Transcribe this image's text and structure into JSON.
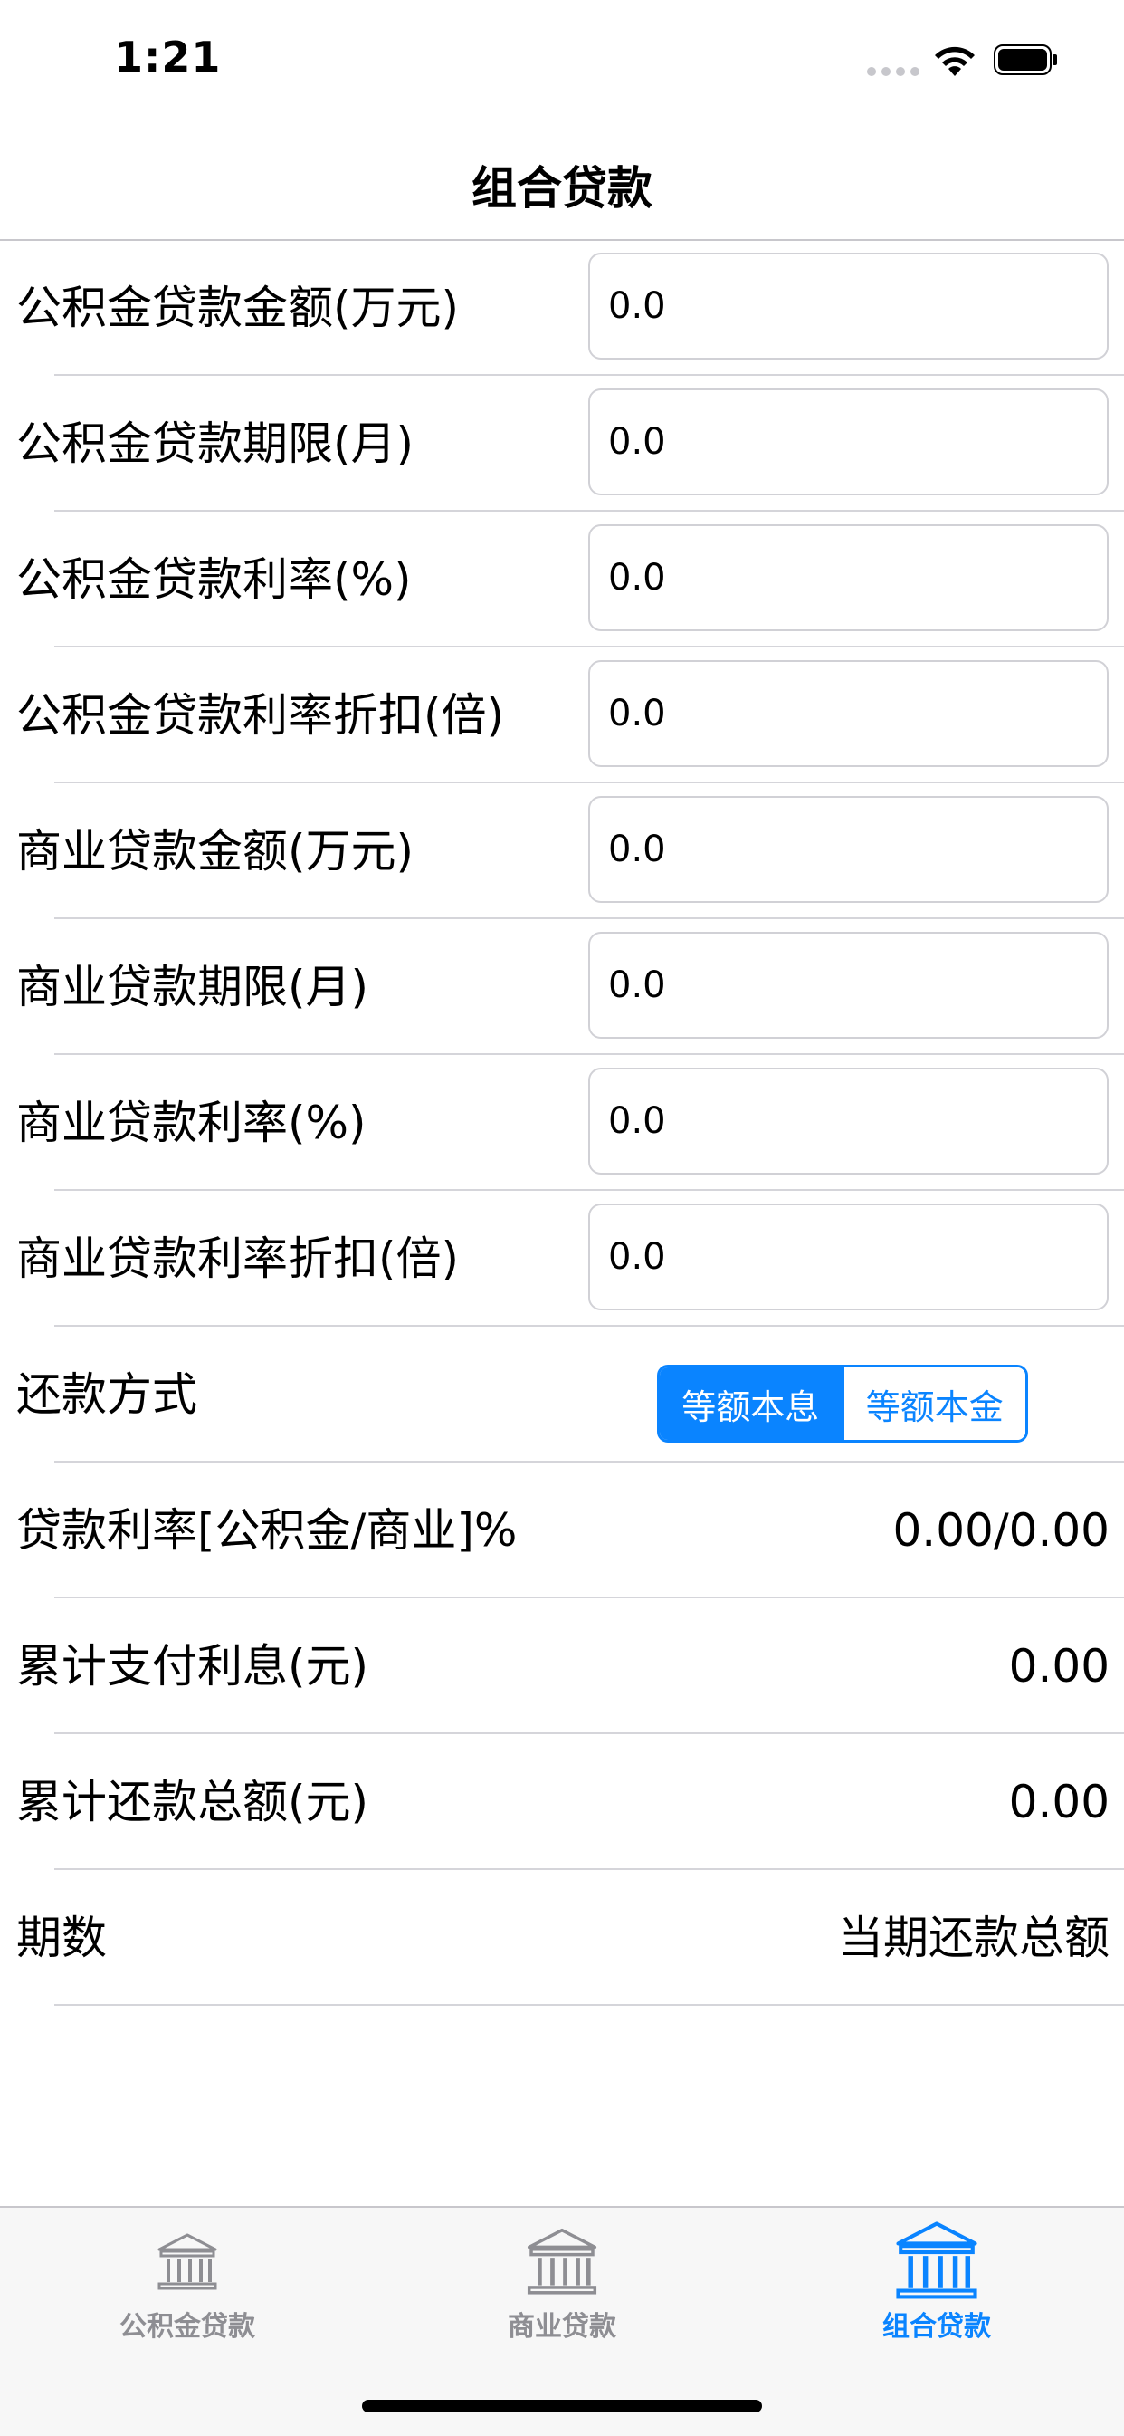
{
  "status_bar": {
    "time": "1:21"
  },
  "nav": {
    "title": "组合贷款"
  },
  "inputs": [
    {
      "label": "公积金贷款金额(万元)",
      "value": "0.0"
    },
    {
      "label": "公积金贷款期限(月)",
      "value": "0.0"
    },
    {
      "label": "公积金贷款利率(%)",
      "value": "0.0"
    },
    {
      "label": "公积金贷款利率折扣(倍)",
      "value": "0.0"
    },
    {
      "label": "商业贷款金额(万元)",
      "value": "0.0"
    },
    {
      "label": "商业贷款期限(月)",
      "value": "0.0"
    },
    {
      "label": "商业贷款利率(%)",
      "value": "0.0"
    },
    {
      "label": "商业贷款利率折扣(倍)",
      "value": "0.0"
    }
  ],
  "repayment": {
    "label": "还款方式",
    "options": [
      "等额本息",
      "等额本金"
    ],
    "selected": "等额本息"
  },
  "results": [
    {
      "label": "贷款利率[公积金/商业]%",
      "value": "0.00/0.00"
    },
    {
      "label": "累计支付利息(元)",
      "value": "0.00"
    },
    {
      "label": "累计还款总额(元)",
      "value": "0.00"
    },
    {
      "label": "期数",
      "value": "当期还款总额"
    }
  ],
  "tabs": [
    {
      "label": "公积金贷款",
      "icon": "bank-icon",
      "active": false
    },
    {
      "label": "商业贷款",
      "icon": "bank-icon",
      "active": false
    },
    {
      "label": "组合贷款",
      "icon": "bank-icon",
      "active": true
    }
  ],
  "colors": {
    "accent": "#0a84ff",
    "inactive": "#8e8e93",
    "separator": "#d5d5da"
  }
}
